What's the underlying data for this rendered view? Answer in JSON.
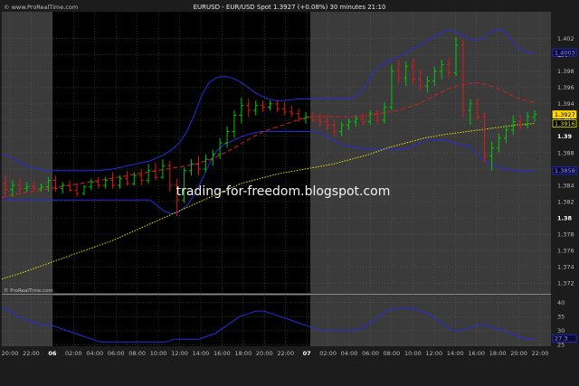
{
  "header": {
    "brand": "© www.ProRealTime.com",
    "title": "EURUSD - EUR/USD Spot   1.3927 (+0.08%)   30 minutes  21:10",
    "copyright_small": "© ProRealTime.com"
  },
  "watermark": "trading-for-freedom.blogspot.com",
  "colors": {
    "background": "#1c1c1c",
    "night_shade": "#000000",
    "session_shade": "#3b3b3b",
    "grid": "#6a6a6a",
    "candle_up": "#00c800",
    "candle_down": "#e01818",
    "bollinger": "#2a2ae0",
    "ma_fast": "#d02020",
    "ma_slow": "#e6e600",
    "indicator": "#2a2ae0"
  },
  "chart_data": {
    "type": "line",
    "title": "EURUSD - EUR/USD Spot   1.3927 (+0.08%)   30 minutes  21:10",
    "x_tick_labels": [
      "20:00",
      "22:00",
      "06",
      "02:00",
      "04:00",
      "06:00",
      "08:00",
      "10:00",
      "12:00",
      "14:00",
      "16:00",
      "18:00",
      "20:00",
      "22:00",
      "07",
      "02:00",
      "04:00",
      "06:00",
      "08:00",
      "10:00",
      "12:00",
      "14:00",
      "16:00",
      "18:00",
      "20:00",
      "22:00"
    ],
    "x_tick_bold": [
      false,
      false,
      true,
      false,
      false,
      false,
      false,
      false,
      false,
      false,
      false,
      false,
      false,
      false,
      true,
      false,
      false,
      false,
      false,
      false,
      false,
      false,
      false,
      false,
      false,
      false
    ],
    "price_panel": {
      "ylim": [
        1.3708,
        1.4053
      ],
      "y_ticks": [
        1.372,
        1.374,
        1.376,
        1.378,
        1.38,
        1.382,
        1.384,
        1.386,
        1.388,
        1.39,
        1.392,
        1.394,
        1.396,
        1.398,
        1.4,
        1.402
      ],
      "y_tick_labels": [
        "1.372",
        "1.374",
        "1.376",
        "1.378",
        "1.38",
        "1.382",
        "1.384",
        "1.386",
        "1.388",
        "1.39",
        "1.392",
        "1.394",
        "1.396",
        "1.398",
        "1.4",
        "1.402"
      ],
      "y_tick_bold": [
        false,
        false,
        false,
        false,
        true,
        false,
        false,
        false,
        false,
        true,
        false,
        false,
        false,
        false,
        true,
        false
      ],
      "last_price_label": "1.3927",
      "ma_label": "1.3916",
      "upper_band_label": "1.4003",
      "lower_band_label": "1.3858",
      "candles": [
        {
          "o": 1.3842,
          "h": 1.3852,
          "l": 1.3828,
          "c": 1.3835
        },
        {
          "o": 1.3835,
          "h": 1.3846,
          "l": 1.3826,
          "c": 1.384
        },
        {
          "o": 1.384,
          "h": 1.3848,
          "l": 1.383,
          "c": 1.3836
        },
        {
          "o": 1.3836,
          "h": 1.3844,
          "l": 1.3832,
          "c": 1.3838
        },
        {
          "o": 1.3838,
          "h": 1.3844,
          "l": 1.3834,
          "c": 1.3836
        },
        {
          "o": 1.3836,
          "h": 1.3842,
          "l": 1.3832,
          "c": 1.3838
        },
        {
          "o": 1.3838,
          "h": 1.385,
          "l": 1.3832,
          "c": 1.3846
        },
        {
          "o": 1.3846,
          "h": 1.3852,
          "l": 1.3832,
          "c": 1.3836
        },
        {
          "o": 1.3836,
          "h": 1.3844,
          "l": 1.383,
          "c": 1.384
        },
        {
          "o": 1.384,
          "h": 1.3846,
          "l": 1.3832,
          "c": 1.3834
        },
        {
          "o": 1.3834,
          "h": 1.3842,
          "l": 1.3826,
          "c": 1.383
        },
        {
          "o": 1.383,
          "h": 1.384,
          "l": 1.3828,
          "c": 1.3838
        },
        {
          "o": 1.3838,
          "h": 1.3848,
          "l": 1.3834,
          "c": 1.3844
        },
        {
          "o": 1.3844,
          "h": 1.385,
          "l": 1.3836,
          "c": 1.384
        },
        {
          "o": 1.384,
          "h": 1.385,
          "l": 1.3836,
          "c": 1.3846
        },
        {
          "o": 1.3846,
          "h": 1.3856,
          "l": 1.3836,
          "c": 1.384
        },
        {
          "o": 1.384,
          "h": 1.3852,
          "l": 1.3836,
          "c": 1.3848
        },
        {
          "o": 1.3848,
          "h": 1.3858,
          "l": 1.384,
          "c": 1.3842
        },
        {
          "o": 1.3842,
          "h": 1.3856,
          "l": 1.384,
          "c": 1.3852
        },
        {
          "o": 1.3852,
          "h": 1.386,
          "l": 1.384,
          "c": 1.3846
        },
        {
          "o": 1.3846,
          "h": 1.3866,
          "l": 1.3842,
          "c": 1.3858
        },
        {
          "o": 1.3858,
          "h": 1.3868,
          "l": 1.3846,
          "c": 1.385
        },
        {
          "o": 1.385,
          "h": 1.3872,
          "l": 1.3848,
          "c": 1.3864
        },
        {
          "o": 1.3864,
          "h": 1.387,
          "l": 1.3832,
          "c": 1.384
        },
        {
          "o": 1.384,
          "h": 1.3848,
          "l": 1.3802,
          "c": 1.3822
        },
        {
          "o": 1.3822,
          "h": 1.3862,
          "l": 1.3818,
          "c": 1.3858
        },
        {
          "o": 1.3858,
          "h": 1.3872,
          "l": 1.3852,
          "c": 1.3866
        },
        {
          "o": 1.3866,
          "h": 1.3876,
          "l": 1.3852,
          "c": 1.386
        },
        {
          "o": 1.386,
          "h": 1.3878,
          "l": 1.3856,
          "c": 1.3872
        },
        {
          "o": 1.3872,
          "h": 1.3884,
          "l": 1.3864,
          "c": 1.3878
        },
        {
          "o": 1.3878,
          "h": 1.3898,
          "l": 1.3872,
          "c": 1.3892
        },
        {
          "o": 1.3892,
          "h": 1.3912,
          "l": 1.3886,
          "c": 1.3906
        },
        {
          "o": 1.3906,
          "h": 1.3932,
          "l": 1.3898,
          "c": 1.3926
        },
        {
          "o": 1.3926,
          "h": 1.3948,
          "l": 1.3916,
          "c": 1.3938
        },
        {
          "o": 1.3938,
          "h": 1.3946,
          "l": 1.3924,
          "c": 1.3932
        },
        {
          "o": 1.3932,
          "h": 1.3944,
          "l": 1.3926,
          "c": 1.3938
        },
        {
          "o": 1.3938,
          "h": 1.3944,
          "l": 1.393,
          "c": 1.3936
        },
        {
          "o": 1.3936,
          "h": 1.3944,
          "l": 1.3932,
          "c": 1.394
        },
        {
          "o": 1.394,
          "h": 1.3944,
          "l": 1.393,
          "c": 1.3934
        },
        {
          "o": 1.3934,
          "h": 1.3942,
          "l": 1.3926,
          "c": 1.393
        },
        {
          "o": 1.393,
          "h": 1.3938,
          "l": 1.3924,
          "c": 1.3928
        },
        {
          "o": 1.3928,
          "h": 1.3934,
          "l": 1.3918,
          "c": 1.3922
        },
        {
          "o": 1.3922,
          "h": 1.393,
          "l": 1.3916,
          "c": 1.3924
        },
        {
          "o": 1.3924,
          "h": 1.393,
          "l": 1.3918,
          "c": 1.392
        },
        {
          "o": 1.392,
          "h": 1.3928,
          "l": 1.3912,
          "c": 1.3918
        },
        {
          "o": 1.3918,
          "h": 1.3926,
          "l": 1.3908,
          "c": 1.3914
        },
        {
          "o": 1.3914,
          "h": 1.392,
          "l": 1.39,
          "c": 1.3906
        },
        {
          "o": 1.3906,
          "h": 1.3918,
          "l": 1.39,
          "c": 1.3914
        },
        {
          "o": 1.3914,
          "h": 1.3922,
          "l": 1.3908,
          "c": 1.3918
        },
        {
          "o": 1.3918,
          "h": 1.3926,
          "l": 1.3912,
          "c": 1.3922
        },
        {
          "o": 1.3922,
          "h": 1.3928,
          "l": 1.3914,
          "c": 1.3918
        },
        {
          "o": 1.3918,
          "h": 1.3932,
          "l": 1.3914,
          "c": 1.3928
        },
        {
          "o": 1.3928,
          "h": 1.3932,
          "l": 1.3916,
          "c": 1.392
        },
        {
          "o": 1.392,
          "h": 1.3942,
          "l": 1.3916,
          "c": 1.3936
        },
        {
          "o": 1.3936,
          "h": 1.3988,
          "l": 1.3932,
          "c": 1.398
        },
        {
          "o": 1.398,
          "h": 1.3994,
          "l": 1.3966,
          "c": 1.3972
        },
        {
          "o": 1.3972,
          "h": 1.3992,
          "l": 1.3962,
          "c": 1.3986
        },
        {
          "o": 1.3986,
          "h": 1.3996,
          "l": 1.3964,
          "c": 1.397
        },
        {
          "o": 1.397,
          "h": 1.3982,
          "l": 1.3956,
          "c": 1.3962
        },
        {
          "o": 1.3962,
          "h": 1.3974,
          "l": 1.3954,
          "c": 1.3968
        },
        {
          "o": 1.3968,
          "h": 1.3986,
          "l": 1.3962,
          "c": 1.398
        },
        {
          "o": 1.398,
          "h": 1.3994,
          "l": 1.397,
          "c": 1.3988
        },
        {
          "o": 1.3988,
          "h": 1.3996,
          "l": 1.3972,
          "c": 1.3978
        },
        {
          "o": 1.3978,
          "h": 1.4022,
          "l": 1.3974,
          "c": 1.4012
        },
        {
          "o": 1.4012,
          "h": 1.4018,
          "l": 1.3924,
          "c": 1.3932
        },
        {
          "o": 1.3932,
          "h": 1.3946,
          "l": 1.3914,
          "c": 1.394
        },
        {
          "o": 1.394,
          "h": 1.3946,
          "l": 1.392,
          "c": 1.3924
        },
        {
          "o": 1.3924,
          "h": 1.393,
          "l": 1.3868,
          "c": 1.3876
        },
        {
          "o": 1.3876,
          "h": 1.3894,
          "l": 1.3858,
          "c": 1.3886
        },
        {
          "o": 1.3886,
          "h": 1.3904,
          "l": 1.388,
          "c": 1.3898
        },
        {
          "o": 1.3898,
          "h": 1.3914,
          "l": 1.3892,
          "c": 1.3908
        },
        {
          "o": 1.3908,
          "h": 1.3926,
          "l": 1.3902,
          "c": 1.3918
        },
        {
          "o": 1.3918,
          "h": 1.3926,
          "l": 1.3908,
          "c": 1.3914
        },
        {
          "o": 1.3914,
          "h": 1.393,
          "l": 1.391,
          "c": 1.3924
        },
        {
          "o": 1.3924,
          "h": 1.3932,
          "l": 1.3918,
          "c": 1.3927
        }
      ],
      "bollinger_upper": [
        1.3878,
        1.3876,
        1.387,
        1.3866,
        1.3862,
        1.386,
        1.3858,
        1.3858,
        1.3858,
        1.3858,
        1.3858,
        1.3858,
        1.3858,
        1.3858,
        1.3859,
        1.386,
        1.3862,
        1.3864,
        1.3866,
        1.3868,
        1.387,
        1.3874,
        1.3878,
        1.3884,
        1.3892,
        1.3906,
        1.3926,
        1.395,
        1.3966,
        1.3972,
        1.3974,
        1.3972,
        1.3968,
        1.3962,
        1.3955,
        1.395,
        1.3946,
        1.3944,
        1.3944,
        1.3945,
        1.3946,
        1.3946,
        1.3946,
        1.3946,
        1.3946,
        1.3946,
        1.3946,
        1.3946,
        1.395,
        1.396,
        1.3976,
        1.3986,
        1.3992,
        1.3996,
        1.4,
        1.4005,
        1.401,
        1.4015,
        1.402,
        1.4025,
        1.403,
        1.403,
        1.4025,
        1.402,
        1.4018,
        1.402,
        1.4028,
        1.4032,
        1.4028,
        1.4016,
        1.4008,
        1.4003,
        1.4003
      ],
      "bollinger_lower": [
        1.3824,
        1.3822,
        1.3822,
        1.3822,
        1.3822,
        1.3822,
        1.3822,
        1.3822,
        1.3822,
        1.3822,
        1.3822,
        1.3822,
        1.3822,
        1.3822,
        1.3822,
        1.3822,
        1.3822,
        1.3822,
        1.3822,
        1.3822,
        1.3822,
        1.3815,
        1.3808,
        1.3805,
        1.3808,
        1.3815,
        1.3828,
        1.3846,
        1.3866,
        1.3882,
        1.389,
        1.3894,
        1.3898,
        1.3902,
        1.3904,
        1.3906,
        1.3906,
        1.3906,
        1.3906,
        1.3906,
        1.3906,
        1.3906,
        1.3906,
        1.3904,
        1.39,
        1.3894,
        1.389,
        1.3888,
        1.3886,
        1.3885,
        1.3884,
        1.3884,
        1.3884,
        1.3884,
        1.3884,
        1.3886,
        1.389,
        1.3894,
        1.3896,
        1.3896,
        1.3895,
        1.3892,
        1.389,
        1.3888,
        1.388,
        1.3872,
        1.3866,
        1.3862,
        1.386,
        1.3858,
        1.3858,
        1.3858,
        1.3858
      ],
      "ma_fast_values": [
        1.3825,
        1.3828,
        1.383,
        1.3832,
        1.3834,
        1.3836,
        1.3838,
        1.384,
        1.3842,
        1.3844,
        1.3846,
        1.3848,
        1.385,
        1.3852,
        1.3854,
        1.3856,
        1.3858,
        1.386,
        1.3862,
        1.3864,
        1.3866,
        1.387,
        1.3874,
        1.388,
        1.3886,
        1.3893,
        1.39,
        1.3906,
        1.391,
        1.3914,
        1.3918,
        1.3922,
        1.3924,
        1.3924,
        1.3924,
        1.3924,
        1.3924,
        1.3925,
        1.3926,
        1.3928,
        1.393,
        1.3932,
        1.3936,
        1.394,
        1.3946,
        1.3952,
        1.3958,
        1.3962,
        1.3964,
        1.3966,
        1.3964,
        1.396,
        1.3954,
        1.3948,
        1.3944,
        1.3942
      ],
      "ma_slow_values": [
        1.3725,
        1.3732,
        1.374,
        1.3748,
        1.3756,
        1.3764,
        1.3772,
        1.3782,
        1.3792,
        1.3802,
        1.3812,
        1.3822,
        1.3832,
        1.3842,
        1.3848,
        1.3854,
        1.3858,
        1.3862,
        1.3866,
        1.3872,
        1.3878,
        1.3886,
        1.3892,
        1.3898,
        1.3902,
        1.3905,
        1.3908,
        1.3911,
        1.3914,
        1.3916
      ]
    },
    "indicator_panel": {
      "ylim": [
        24.5,
        42.5
      ],
      "y_ticks": [
        25,
        30,
        35,
        40
      ],
      "y_tick_labels": [
        "25",
        "30",
        "35",
        "40"
      ],
      "last_label": "27.3",
      "values": [
        38,
        37,
        35,
        34,
        33,
        32,
        32,
        31,
        30,
        29,
        28,
        27,
        26,
        26,
        26,
        26,
        26,
        26,
        26,
        26,
        26,
        27,
        27,
        27,
        27,
        28,
        29,
        31,
        33,
        35,
        36,
        37,
        37,
        36,
        35,
        34,
        33,
        32,
        31,
        30,
        30,
        30,
        30,
        30,
        31,
        33,
        35,
        37,
        38,
        38,
        38,
        37,
        36,
        34,
        32,
        30,
        30,
        31,
        32,
        32,
        31,
        30,
        29,
        28,
        27,
        27
      ]
    }
  }
}
